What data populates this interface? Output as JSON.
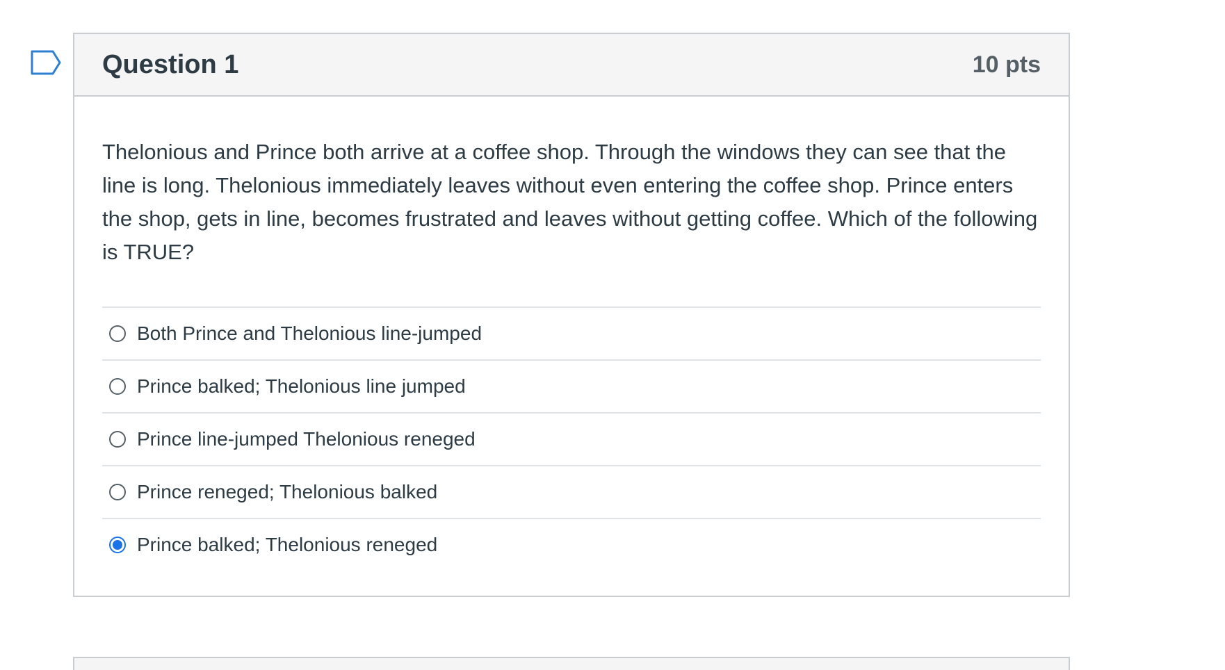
{
  "question": {
    "title": "Question 1",
    "points": "10 pts",
    "text": "Thelonious and Prince both arrive at a coffee shop.  Through the windows they can see that the line is long.  Thelonious immediately leaves without even entering the coffee shop.  Prince enters the shop, gets in line, becomes frustrated and leaves without getting coffee.  Which of the following is TRUE?",
    "answers": [
      {
        "label": "Both Prince and Thelonious line-jumped",
        "selected": false
      },
      {
        "label": "Prince balked; Thelonious line jumped",
        "selected": false
      },
      {
        "label": "Prince line-jumped Thelonious reneged",
        "selected": false
      },
      {
        "label": "Prince reneged; Thelonious balked",
        "selected": false
      },
      {
        "label": "Prince balked; Thelonious reneged",
        "selected": true
      }
    ]
  },
  "colors": {
    "accent": "#1a73e8",
    "border": "#c7cdd1",
    "header_bg": "#f5f5f5",
    "text": "#2d3b45"
  },
  "icons": {
    "flag": "bookmark-flag-icon"
  }
}
